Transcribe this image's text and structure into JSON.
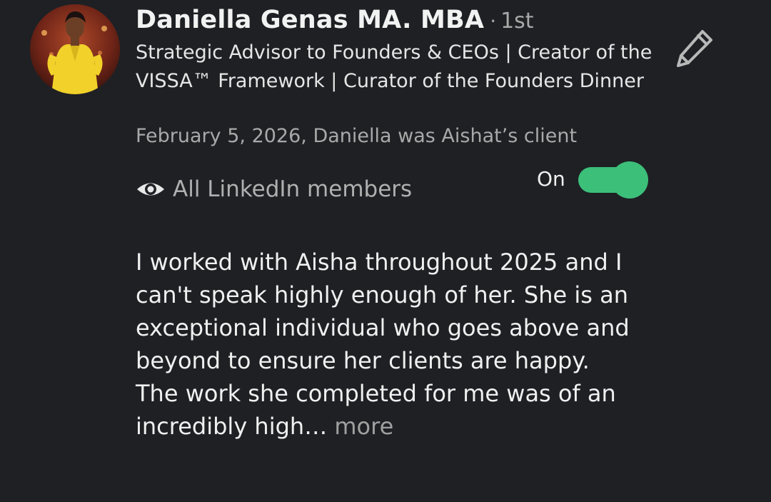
{
  "recommender": {
    "name": "Daniella Genas MA. MBA",
    "separator": "·",
    "connection_degree": "1st",
    "headline": "Strategic Advisor to Founders & CEOs | Creator of the VISSA™ Framework | Curator of the Founders Dinner",
    "relationship": "February 5, 2026, Daniella was Aishat’s client"
  },
  "visibility": {
    "icon": "eye-icon",
    "label": "All LinkedIn members",
    "toggle_label": "On",
    "toggle_state": "on",
    "toggle_color": "#3cbf79"
  },
  "recommendation": {
    "text": "I worked with Aisha throughout 2025 and I can't speak highly enough of her. She is an exceptional individual who goes above and beyond to ensure her clients are happy. The work she completed for me was of an incredibly high…",
    "more_label": "more"
  },
  "actions": {
    "edit_icon": "pencil-icon"
  },
  "colors": {
    "background": "#1e2024",
    "accent": "#3cbf79"
  }
}
